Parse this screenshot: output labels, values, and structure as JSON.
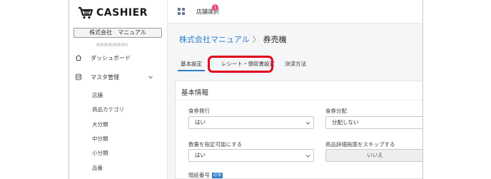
{
  "brand": {
    "name": "CASHIER"
  },
  "sidebar": {
    "company": "株式会社　マニュアル",
    "nav": [
      {
        "label": "ダッシュボード"
      },
      {
        "label": "マスタ管理"
      }
    ],
    "sub_items": [
      "店舗",
      "商品カテゴリ",
      "大分類",
      "中分類",
      "小分類",
      "品番"
    ]
  },
  "topbar": {
    "store_select": "店舗選択",
    "badge_count": "1"
  },
  "breadcrumb": {
    "company": "株式会社マニュアル",
    "separator": "〉",
    "page": "券売機"
  },
  "tabs": [
    {
      "label": "基本設定",
      "active": true
    },
    {
      "label": "レシート・領収書設定",
      "active": false,
      "highlighted": true
    },
    {
      "label": "決済方法",
      "active": false
    }
  ],
  "section": {
    "title": "基本情報",
    "fields": [
      {
        "label": "食券発行",
        "value": "はい"
      },
      {
        "label": "食券分配",
        "value": "分配しない"
      },
      {
        "label": "数量を指定可能にする",
        "value": "はい"
      },
      {
        "label": "商品詳細画面をスキップする",
        "value": "いいえ"
      },
      {
        "label": "暗証番号",
        "required_badge": "必須"
      }
    ]
  },
  "colors": {
    "accent": "#2f7ec6",
    "highlight": "#e3001b",
    "badge": "#e8447a"
  }
}
